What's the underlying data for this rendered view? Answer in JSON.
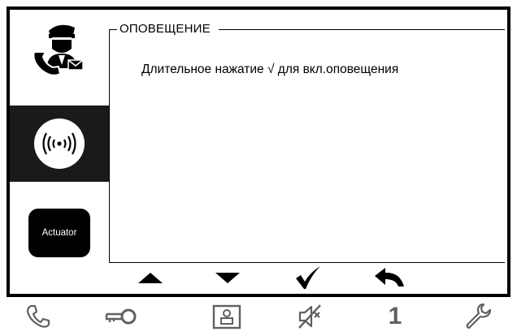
{
  "sidebar": {
    "items": [
      {
        "name": "concierge-icon"
      },
      {
        "name": "broadcast-icon",
        "selected": true
      },
      {
        "name": "actuator-icon",
        "label": "Actuator"
      }
    ]
  },
  "panel": {
    "title": "ОПОВЕЩЕНИЕ",
    "text": "Длительное нажатие √ для вкл.оповещения"
  },
  "nav": {
    "icons": [
      "arrow-up-icon",
      "arrow-down-icon",
      "checkmark-icon",
      "back-arrow-icon"
    ]
  },
  "bottom_bar": {
    "icons": [
      "phone-icon",
      "key-icon",
      "contact-card-icon",
      "mute-icon",
      "channel-number",
      "wrench-icon"
    ],
    "channel_label": "1"
  },
  "colors": {
    "bezel": "#000000",
    "selected_bg": "#1a1a1a",
    "bottom_icon": "#606060"
  }
}
